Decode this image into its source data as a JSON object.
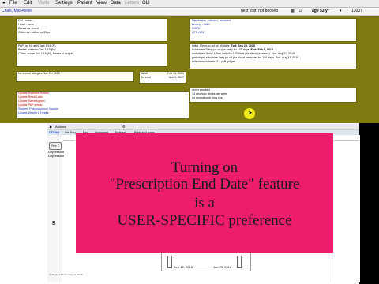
{
  "menu": [
    "File",
    "Edit",
    "Visits",
    "Settings",
    "Patient",
    "View",
    "Data",
    "Letters",
    "OLI"
  ],
  "patient": {
    "name": "Chalk, Mal-Annie",
    "visit": "next visit: not booked",
    "age": "age 53 yr",
    "id": "13007"
  },
  "history": [
    "DM - none",
    "Heart - none",
    "Breast ca - none",
    "Colon ca - father ca 55yo"
  ],
  "problems": [
    "Depression - chronic, recurrent",
    "Anxiety - GAD",
    "COPD",
    "HTN (401)"
  ],
  "meds_left": [
    "PAP: no Hx abN, last 1/14 (N)",
    "Breast: mammo Dec 1/15 (N)",
    "Colon: scope Jun 1/15 (N), Needs u/ scope"
  ],
  "meds_right": [
    {
      "text": "lipitor 20mg po od for 90 days",
      "end": "End: Sep 28, 2015"
    },
    {
      "text": "duloxetine 20mg po od (for pain) for 100 days",
      "end": "End: Feb 9, 2018"
    },
    {
      "text": "amlodipine 5 mg 1 6ms daily for 100 days (for blood pressure)",
      "end": "End: Aug 11, 2019"
    },
    {
      "text": "perindopril erbumine 4mg po od (for blood pressure) for 100 days",
      "end": "End: Aug 11, 2019"
    },
    {
      "text": "salbutamol inhaler: 2-4 puff qid prn",
      "end": ""
    }
  ],
  "allergy": "No known allergies Nov 26, 2015",
  "diet": [
    {
      "label": "Advil",
      "date": "Feb 11, 2009"
    },
    {
      "label": "flu shot",
      "date": "Nov 1, 2017"
    }
  ],
  "reminders": [
    "Update Diabetes Screen",
    "Update Renal Labs",
    "Update Mammogram",
    "Update PAP smear",
    "Suggest Pneumococcal Vaccine",
    "Update Weight & Height"
  ],
  "social": [
    "never smoked",
    "14 alcoholic drinks per week",
    "no recreational drug use"
  ],
  "lower": {
    "actions_label": "Actions",
    "tabs": [
      "OCEAN",
      "Lab Req",
      "Fax",
      "Worksheet",
      "Referral",
      "Published forms"
    ],
    "chip": "Prev C",
    "left_labels": [
      "Depression",
      "Depression"
    ],
    "graph_dates": [
      "Sep 12, 2015",
      "Jan 25, 2018"
    ],
    "graph_letter": "B",
    "footer": "© Jacques Bhattacharyya, 2018"
  },
  "overlay": {
    "lines": [
      "Turning on",
      "\"Prescription End Date\" feature",
      "is a",
      "USER-SPECIFIC preference"
    ],
    "color": "#ee1c6d"
  }
}
